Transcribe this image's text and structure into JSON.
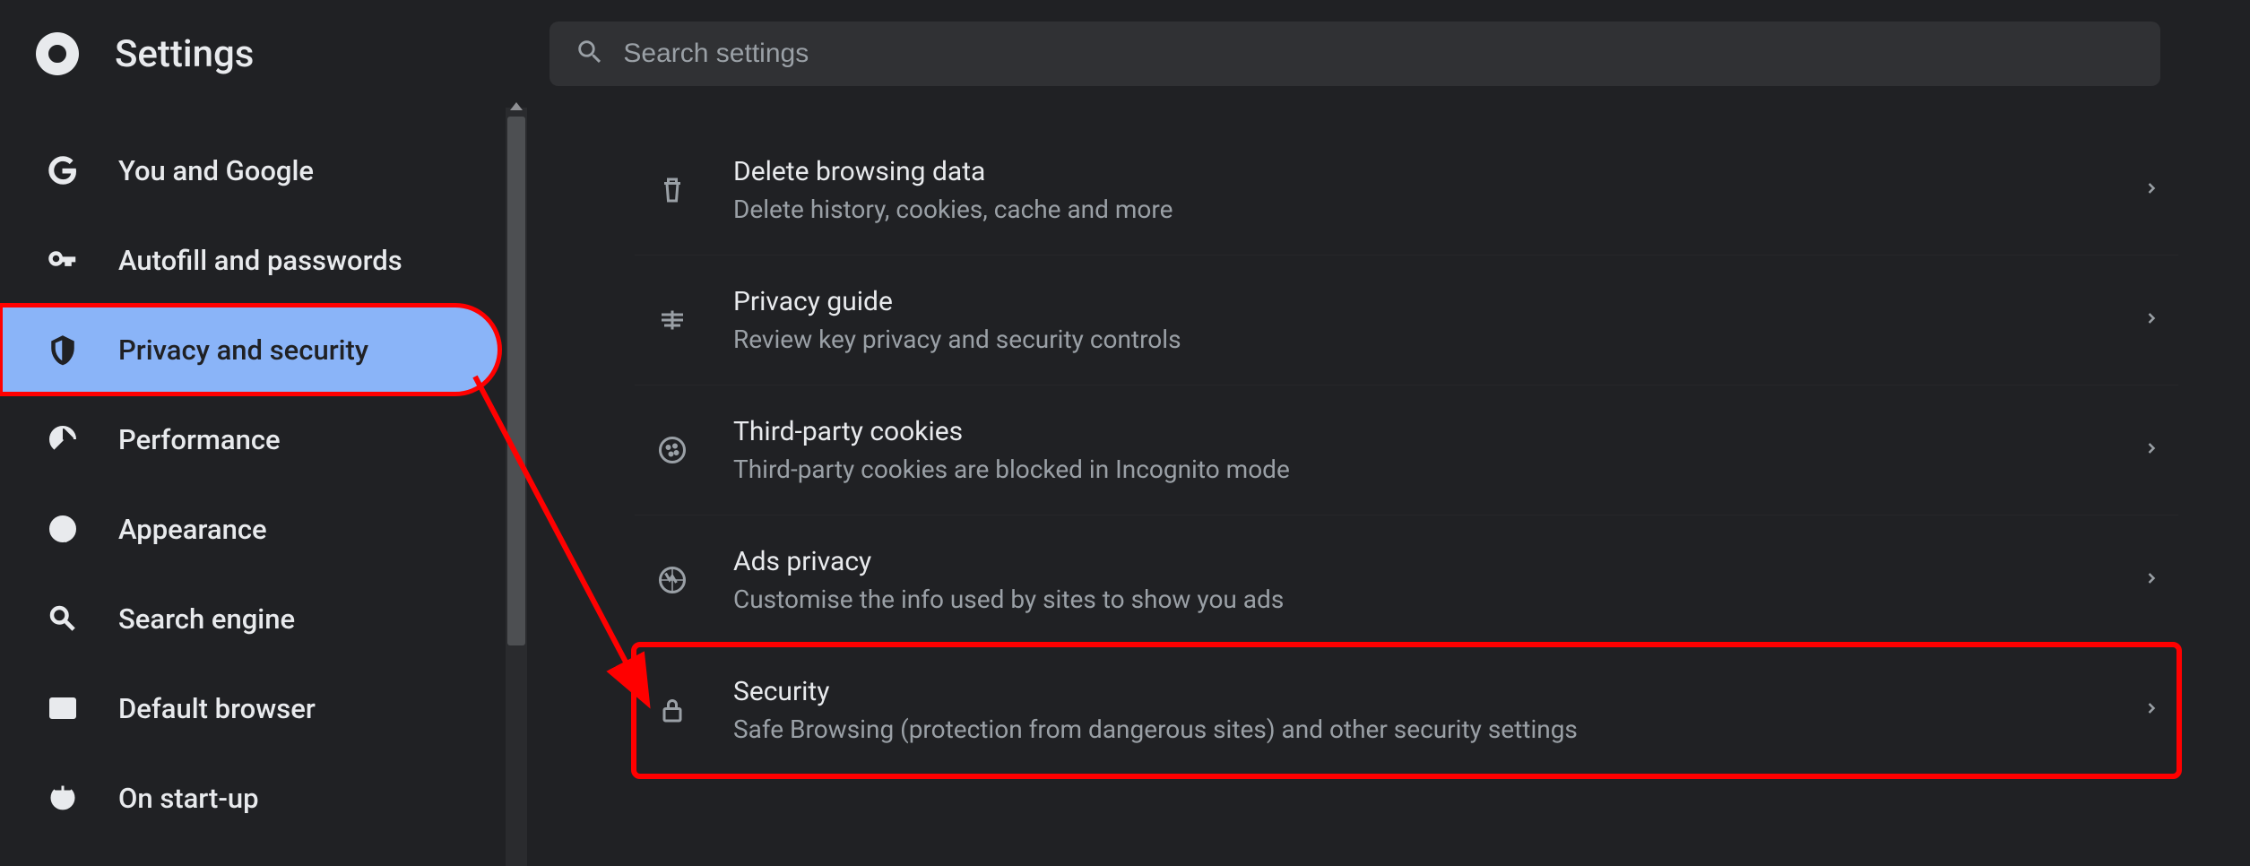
{
  "header": {
    "title": "Settings",
    "search_placeholder": "Search settings"
  },
  "sidebar": {
    "items": [
      {
        "id": "you-and-google",
        "label": "You and Google",
        "icon": "google-g-icon"
      },
      {
        "id": "autofill",
        "label": "Autofill and passwords",
        "icon": "key-icon"
      },
      {
        "id": "privacy",
        "label": "Privacy and security",
        "icon": "shield-icon",
        "active": true,
        "highlighted": true
      },
      {
        "id": "performance",
        "label": "Performance",
        "icon": "speedometer-icon"
      },
      {
        "id": "appearance",
        "label": "Appearance",
        "icon": "palette-icon"
      },
      {
        "id": "search-engine",
        "label": "Search engine",
        "icon": "search-icon"
      },
      {
        "id": "default-browser",
        "label": "Default browser",
        "icon": "browser-window-icon"
      },
      {
        "id": "startup",
        "label": "On start-up",
        "icon": "power-icon"
      }
    ]
  },
  "main": {
    "rows": [
      {
        "id": "delete-data",
        "icon": "trash-icon",
        "title": "Delete browsing data",
        "desc": "Delete history, cookies, cache and more"
      },
      {
        "id": "privacy-guide",
        "icon": "guide-icon",
        "title": "Privacy guide",
        "desc": "Review key privacy and security controls"
      },
      {
        "id": "third-party-cookies",
        "icon": "cookie-icon",
        "title": "Third-party cookies",
        "desc": "Third-party cookies are blocked in Incognito mode"
      },
      {
        "id": "ads-privacy",
        "icon": "ads-icon",
        "title": "Ads privacy",
        "desc": "Customise the info used by sites to show you ads"
      },
      {
        "id": "security",
        "icon": "lock-icon",
        "title": "Security",
        "desc": "Safe Browsing (protection from dangerous sites) and other security settings",
        "highlighted": true
      }
    ]
  },
  "annotations": {
    "highlight_color": "#ff0000",
    "arrow": {
      "from": "sidebar-item-privacy",
      "to": "settings-row-security"
    }
  }
}
